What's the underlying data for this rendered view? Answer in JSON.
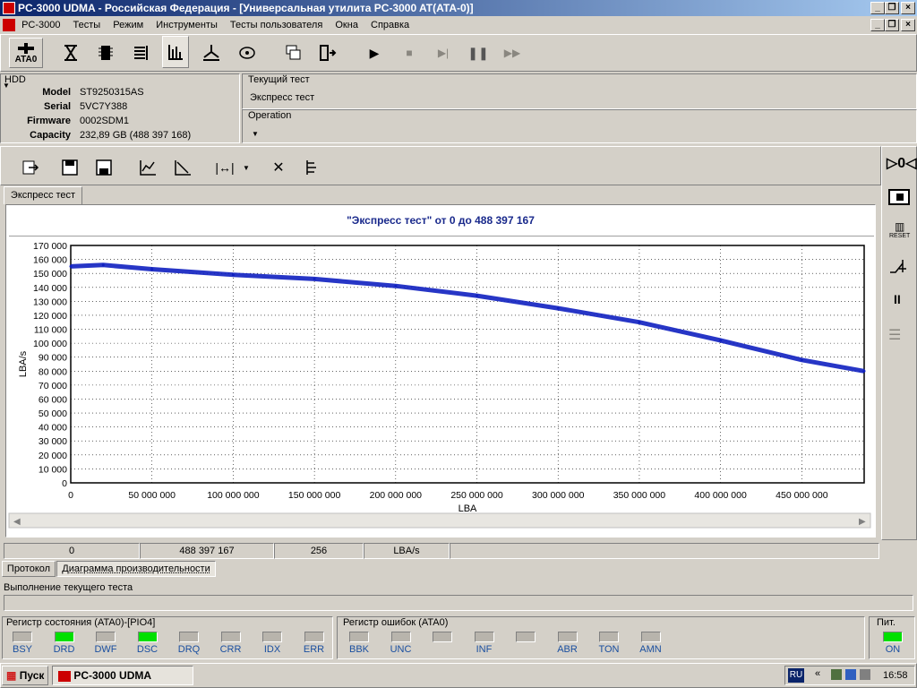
{
  "window": {
    "title": "PC-3000 UDMA - Российская Федерация - [Универсальная утилита PC-3000 AT(ATA-0)]"
  },
  "menu": [
    "PC-3000",
    "Тесты",
    "Режим",
    "Инструменты",
    "Тесты пользователя",
    "Окна",
    "Справка"
  ],
  "toolbar": {
    "ata_label": "ATA0"
  },
  "hdd": {
    "section_label": "HDD",
    "fields": [
      {
        "label": "Model",
        "value": "ST9250315AS"
      },
      {
        "label": "Serial",
        "value": "5VC7Y388"
      },
      {
        "label": "Firmware",
        "value": "0002SDM1"
      },
      {
        "label": "Capacity",
        "value": "232,89 GB (488 397 168)"
      }
    ]
  },
  "current_test": {
    "label": "Текущий тест",
    "value": "Экспресс тест",
    "operation_label": "Operation"
  },
  "tab": {
    "label": "Экспресс тест"
  },
  "chart_data": {
    "type": "line",
    "title": "\"Экспресс тест\" от 0 до 488 397 167",
    "xlabel": "LBA",
    "ylabel": "LBA/s",
    "xlim": [
      0,
      488397167
    ],
    "ylim": [
      0,
      170000
    ],
    "x_ticks": [
      "0",
      "50 000 000",
      "100 000 000",
      "150 000 000",
      "200 000 000",
      "250 000 000",
      "300 000 000",
      "350 000 000",
      "400 000 000",
      "450 000 000"
    ],
    "y_ticks": [
      "0",
      "10 000",
      "20 000",
      "30 000",
      "40 000",
      "50 000",
      "60 000",
      "70 000",
      "80 000",
      "90 000",
      "100 000",
      "110 000",
      "120 000",
      "130 000",
      "140 000",
      "150 000",
      "160 000",
      "170 000"
    ],
    "grid": true,
    "series": [
      {
        "color": "#1020c0",
        "x": [
          0,
          20000000,
          50000000,
          100000000,
          150000000,
          200000000,
          250000000,
          300000000,
          350000000,
          400000000,
          450000000,
          488397167
        ],
        "y": [
          155000,
          156000,
          153000,
          149000,
          146000,
          141000,
          134000,
          125000,
          115000,
          102000,
          88000,
          80000
        ]
      }
    ]
  },
  "status": {
    "start": "0",
    "end": "488 397 167",
    "block": "256",
    "unit": "LBA/s"
  },
  "bottom_tabs": {
    "protocol": "Протокол",
    "perf": "Диаграмма производительности"
  },
  "progress_label": "Выполнение текущего теста",
  "status_register": {
    "title": "Регистр состояния (ATA0)-[PIO4]",
    "leds": [
      {
        "name": "BSY",
        "on": false
      },
      {
        "name": "DRD",
        "on": true
      },
      {
        "name": "DWF",
        "on": false
      },
      {
        "name": "DSC",
        "on": true
      },
      {
        "name": "DRQ",
        "on": false
      },
      {
        "name": "CRR",
        "on": false
      },
      {
        "name": "IDX",
        "on": false
      },
      {
        "name": "ERR",
        "on": false
      }
    ]
  },
  "error_register": {
    "title": "Регистр ошибок  (ATA0)",
    "leds": [
      {
        "name": "BBK",
        "on": false
      },
      {
        "name": "UNC",
        "on": false
      },
      {
        "name": "",
        "on": false
      },
      {
        "name": "INF",
        "on": false
      },
      {
        "name": "",
        "on": false
      },
      {
        "name": "ABR",
        "on": false
      },
      {
        "name": "TON",
        "on": false
      },
      {
        "name": "AMN",
        "on": false
      }
    ]
  },
  "power": {
    "title": "Пит.",
    "label": "ON",
    "on": true
  },
  "taskbar": {
    "start": "Пуск",
    "app": "PC-3000 UDMA",
    "lang": "RU",
    "time": "16:58"
  },
  "colors": {
    "accent": "#0a246a",
    "led_on": "#00e000",
    "series": "#1020c0",
    "title_blue": "#1a2a8c"
  }
}
